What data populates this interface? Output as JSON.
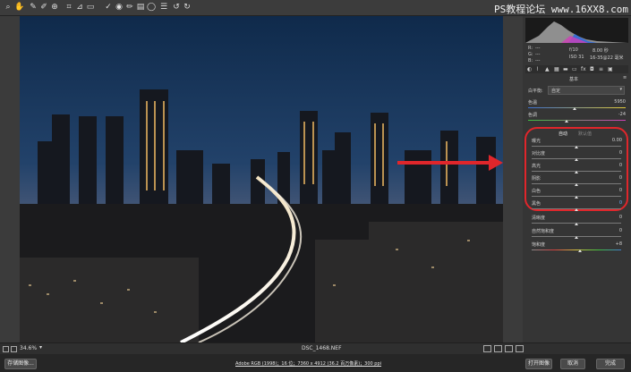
{
  "watermark": "PS教程论坛 www.16XX8.com",
  "toolbar": {
    "tools": [
      "hand-tool",
      "zoom-tool",
      "white-balance-tool",
      "color-sampler-tool",
      "targeted-adjustment-tool",
      "crop-tool",
      "straighten-tool",
      "transform-tool",
      "spot-removal-tool",
      "red-eye-tool",
      "adjustment-brush-tool",
      "graduated-filter-tool",
      "radial-filter-tool",
      "preferences-tool",
      "rotate-left-tool",
      "rotate-right-tool"
    ]
  },
  "camera_info": {
    "r": "R:",
    "g": "G:",
    "b": "B:",
    "r_val": "---",
    "g_val": "---",
    "b_val": "---",
    "aperture": "f/10",
    "shutter": "8.00 秒",
    "iso": "ISO 31",
    "lens": "16-35@22 毫米"
  },
  "panel": {
    "section_title": "基本",
    "white_balance_label": "白平衡:",
    "white_balance_value": "自定",
    "temperature_label": "色温",
    "temperature_value": "5950",
    "tint_label": "色调",
    "tint_value": "-24",
    "auto_label": "自动",
    "default_label": "默认值",
    "tone": [
      {
        "label": "曝光",
        "value": "0.00"
      },
      {
        "label": "对比度",
        "value": "0"
      },
      {
        "label": "高光",
        "value": "0"
      },
      {
        "label": "阴影",
        "value": "0"
      },
      {
        "label": "白色",
        "value": "0"
      },
      {
        "label": "黑色",
        "value": "0"
      }
    ],
    "presence": [
      {
        "label": "清晰度",
        "value": "0"
      },
      {
        "label": "自然饱和度",
        "value": "0"
      },
      {
        "label": "饱和度",
        "value": "+8"
      }
    ]
  },
  "status": {
    "zoom": "34.6%",
    "filename": "DSC_1468.NEF"
  },
  "bottom": {
    "save_button": "存储图像...",
    "workflow_info": "Adobe RGB (1998)；16 位；7360 x 4912 (36.2 百万像素)；300 ppi",
    "open_button": "打开图像",
    "cancel_button": "取消",
    "done_button": "完成"
  },
  "colors": {
    "accent_red": "#e0262b",
    "panel_bg": "#353535"
  }
}
